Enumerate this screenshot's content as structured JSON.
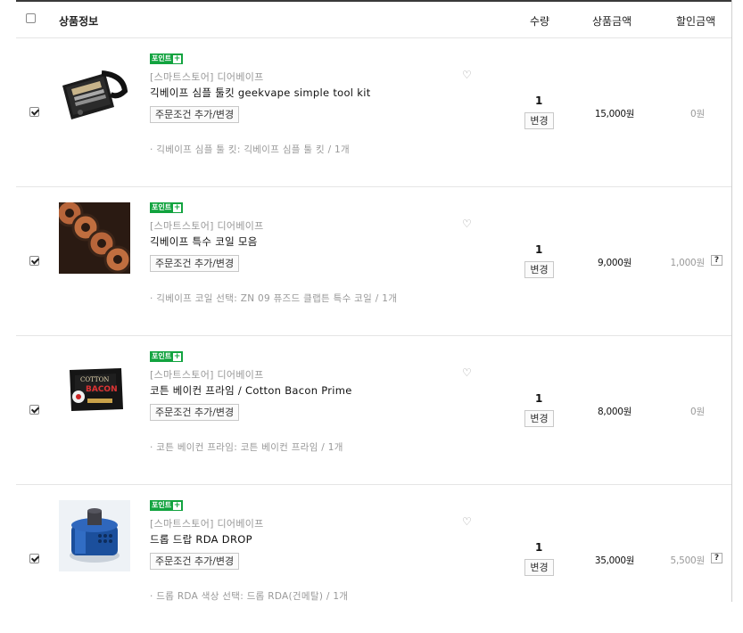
{
  "header": {
    "product_info": "상품정보",
    "quantity": "수량",
    "price": "상품금액",
    "discount": "할인금액"
  },
  "items": [
    {
      "checked": true,
      "badge": "포인트",
      "badge_plus": "+",
      "seller": "[스마트스토어] 디어베이프",
      "name": "긱베이프 심플 툴킷 geekvape simple tool kit",
      "option_button": "주문조건 추가/변경",
      "option": "· 긱베이프 심플 툴 킷: 긱베이프 심플 툴 킷 / 1개",
      "quantity": "1",
      "change_button": "변경",
      "price": "15,000원",
      "discount": "0원",
      "has_help": false
    },
    {
      "checked": true,
      "badge": "포인트",
      "badge_plus": "+",
      "seller": "[스마트스토어] 디어베이프",
      "name": "긱베이프 특수 코일 모음",
      "option_button": "주문조건 추가/변경",
      "option": "· 긱베이프 코일 선택: ZN 09 퓨즈드 클랩튼 특수 코일 / 1개",
      "quantity": "1",
      "change_button": "변경",
      "price": "9,000원",
      "discount": "1,000원",
      "has_help": true
    },
    {
      "checked": true,
      "badge": "포인트",
      "badge_plus": "+",
      "seller": "[스마트스토어] 디어베이프",
      "name": "코튼 베이컨 프라임 / Cotton Bacon Prime",
      "option_button": "주문조건 추가/변경",
      "option": "· 코튼 베이컨 프라임: 코튼 베이컨 프라임 / 1개",
      "quantity": "1",
      "change_button": "변경",
      "price": "8,000원",
      "discount": "0원",
      "has_help": false
    },
    {
      "checked": true,
      "badge": "포인트",
      "badge_plus": "+",
      "seller": "[스마트스토어] 디어베이프",
      "name": "드롭 드랍 RDA DROP",
      "option_button": "주문조건 추가/변경",
      "option": "· 드롭 RDA 색상 선택: 드롭 RDA(건메탈) / 1개",
      "quantity": "1",
      "change_button": "변경",
      "price": "35,000원",
      "discount": "5,500원",
      "has_help": true
    }
  ],
  "help_label": "?",
  "colors": {
    "point_badge": "#12a33f",
    "muted_text": "#999999",
    "border": "#e5e5e5"
  },
  "icons": {
    "wishlist": "heart-outline-icon",
    "help": "question-icon"
  }
}
